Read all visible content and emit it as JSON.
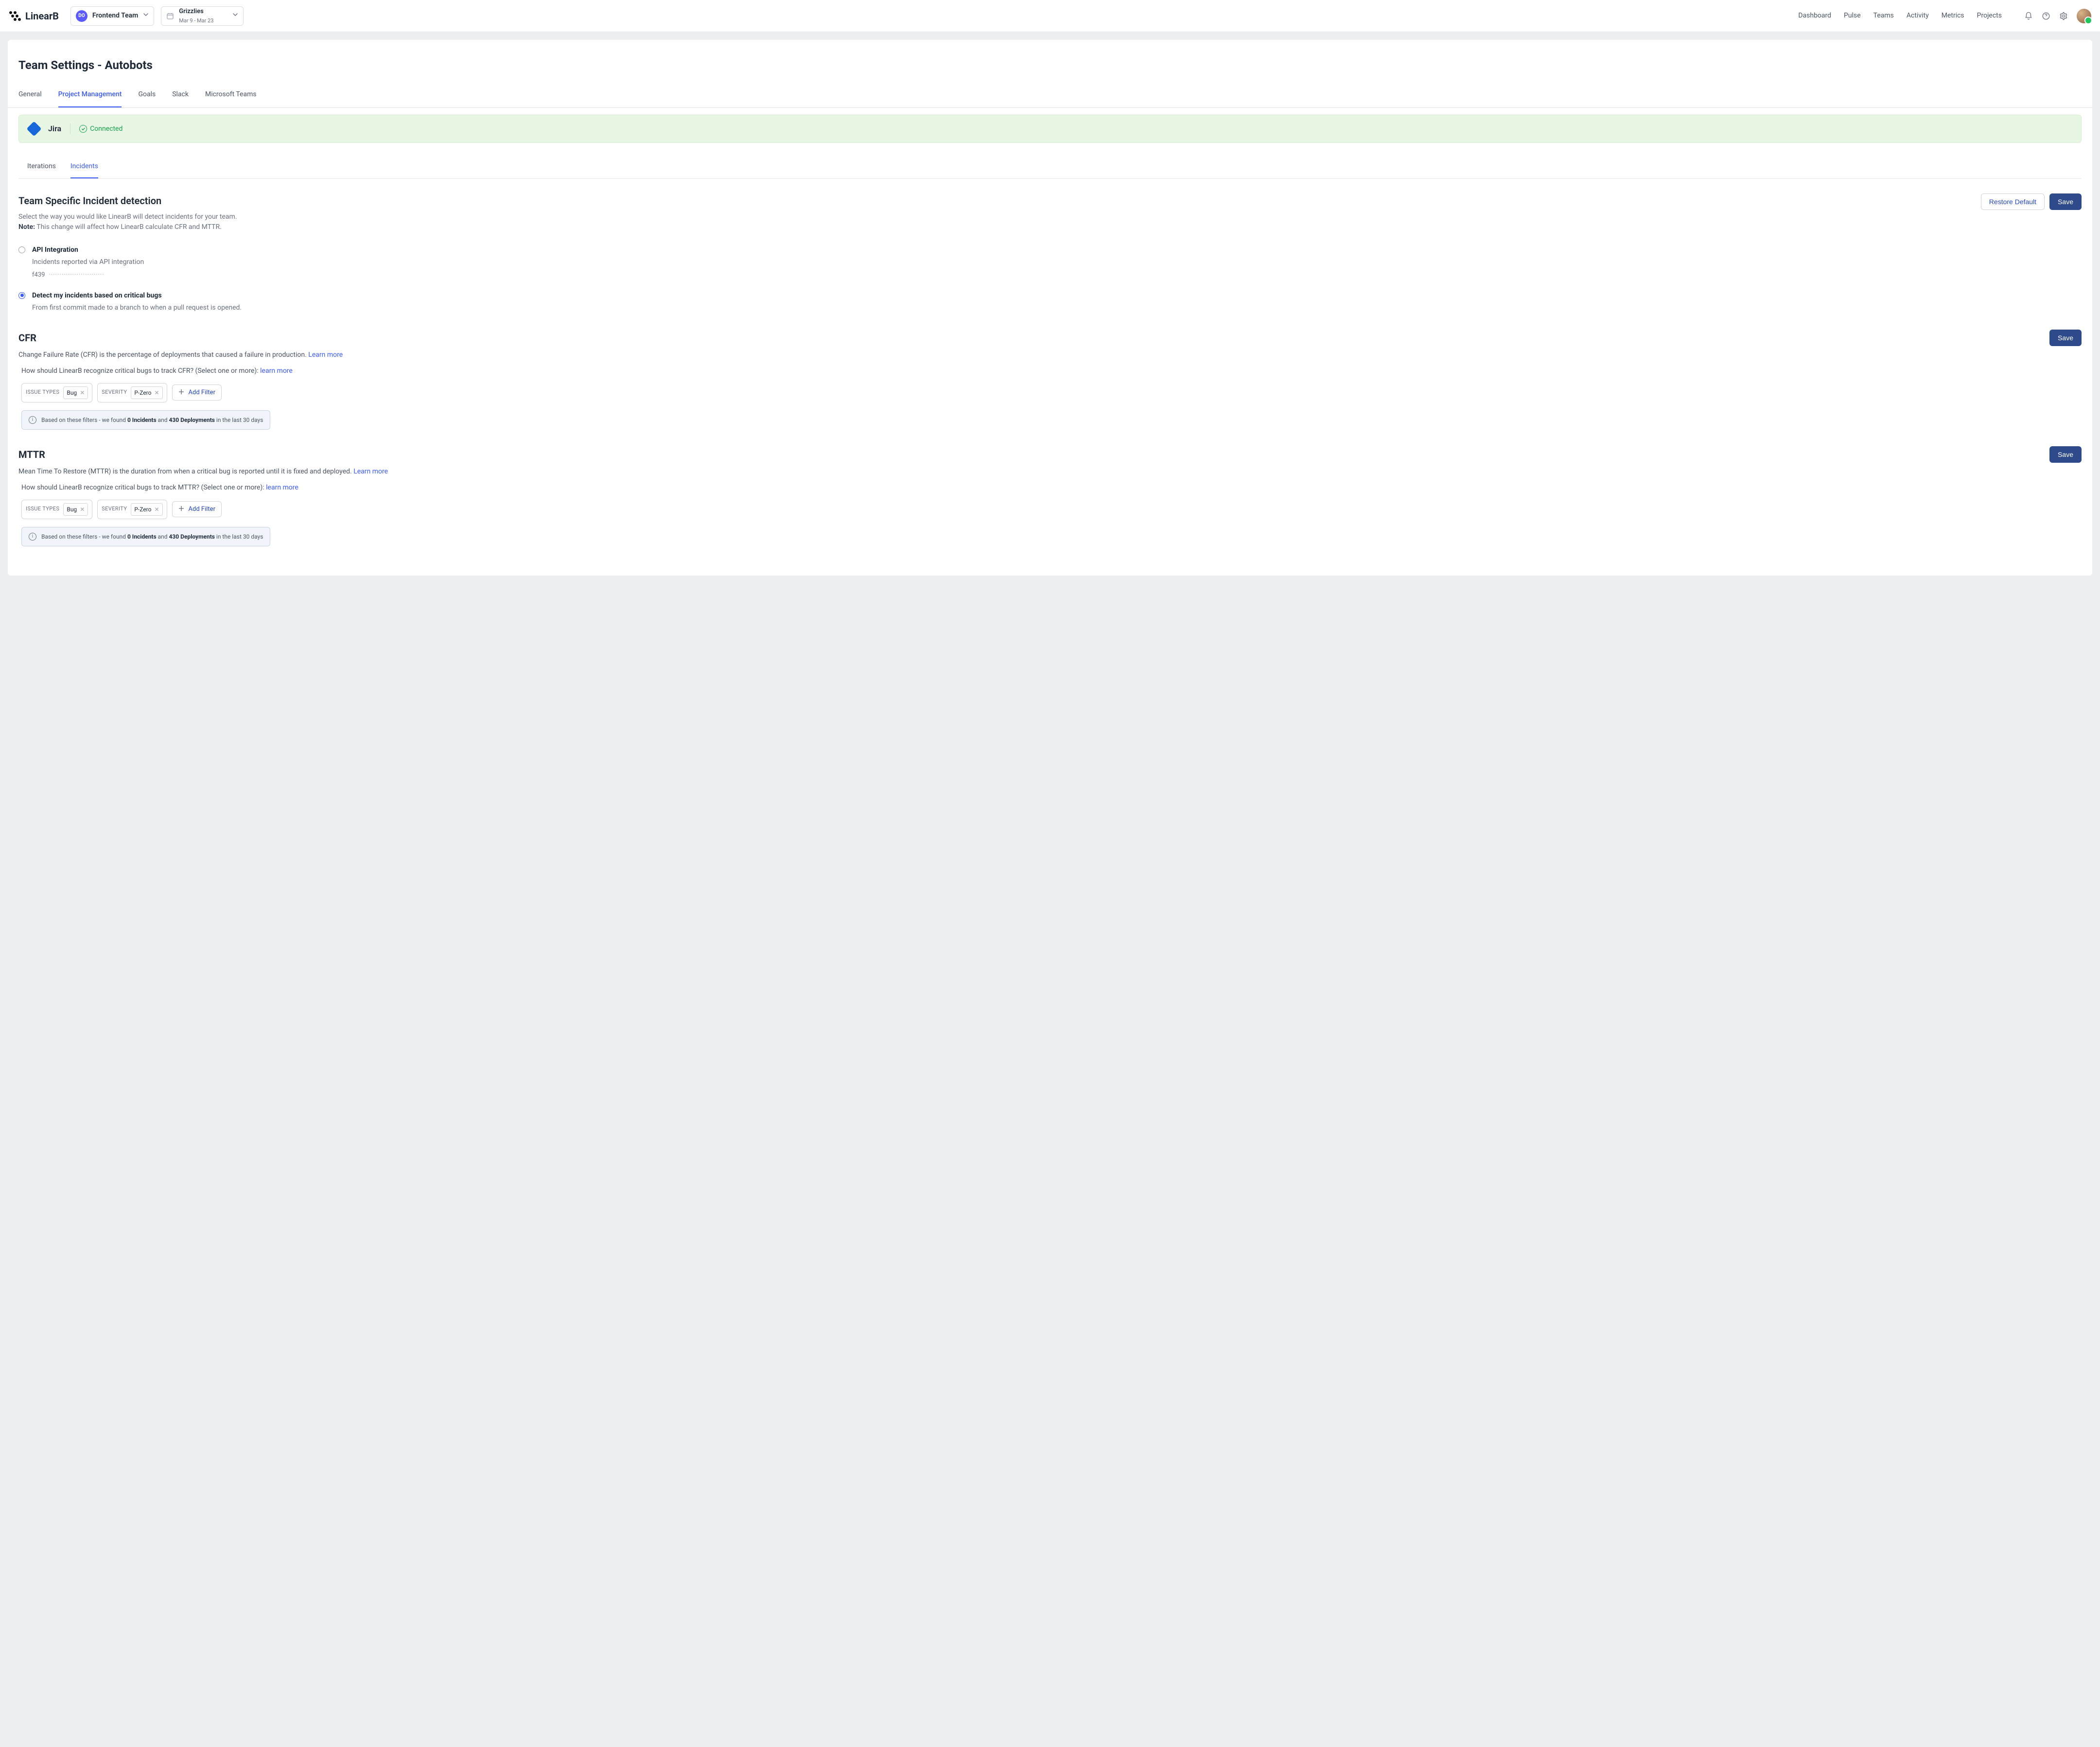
{
  "app": {
    "logo_text": "LinearB"
  },
  "header": {
    "team_selector": {
      "avatar_initials": "DO",
      "label": "Frontend Team"
    },
    "context_selector": {
      "label": "Grizzlies",
      "sub": "Mar 9 - Mar 23"
    },
    "nav": {
      "dashboard": "Dashboard",
      "pulse": "Pulse",
      "teams": "Teams",
      "activity": "Activity",
      "metrics": "Metrics",
      "projects": "Projects"
    }
  },
  "page": {
    "title": "Team Settings - Autobots",
    "tabs": {
      "general": "General",
      "pm": "Project Management",
      "goals": "Goals",
      "slack": "Slack",
      "msteams": "Microsoft Teams"
    }
  },
  "integration": {
    "name": "Jira",
    "status": "Connected"
  },
  "subtabs": {
    "iterations": "Iterations",
    "incidents": "Incidents"
  },
  "detection": {
    "title": "Team Specific Incident detection",
    "desc1": "Select the way you would like LinearB will detect incidents for your team.",
    "note_label": "Note:",
    "note_text": " This change will affect how LinearB calculate CFR and MTTR.",
    "buttons": {
      "restore": "Restore Default",
      "save": "Save"
    },
    "options": {
      "api": {
        "label": "API Integration",
        "sub": "Incidents reported via API integration",
        "id": "f439"
      },
      "bugs": {
        "label": "Detect my incidents based on critical bugs",
        "sub": "From first commit made to a branch to when a pull request is opened."
      }
    }
  },
  "cfr": {
    "title": "CFR",
    "desc": "Change Failure Rate (CFR) is the percentage of deployments that caused a failure in production. ",
    "learn_more": "Learn more",
    "question": "How should LinearB recognize critical bugs to track CFR? (Select one or more): ",
    "learn_more2": "learn more",
    "save": "Save",
    "filters": {
      "issue_types_label": "ISSUE TYPES",
      "issue_types_value": "Bug",
      "severity_label": "SEVERITY",
      "severity_value": "P-Zero",
      "add": "Add Filter"
    },
    "info": {
      "prefix": "Based on these filters - we found ",
      "incidents": "0 Incidents",
      "and": " and ",
      "deployments": "430 Deployments",
      "suffix": " in the last 30 days"
    }
  },
  "mttr": {
    "title": "MTTR",
    "desc": "Mean Time To Restore (MTTR) is the duration from when a critical bug is reported until it is fixed and deployed. ",
    "learn_more": "Learn more",
    "question": "How should LinearB recognize critical bugs to track MTTR? (Select one or more): ",
    "learn_more2": "learn more",
    "save": "Save",
    "filters": {
      "issue_types_label": "ISSUE TYPES",
      "issue_types_value": "Bug",
      "severity_label": "SEVERITY",
      "severity_value": "P-Zero",
      "add": "Add Filter"
    },
    "info": {
      "prefix": "Based on these filters - we found ",
      "incidents": "0 Incidents",
      "and": " and ",
      "deployments": "430 Deployments",
      "suffix": " in the last 30 days"
    }
  }
}
